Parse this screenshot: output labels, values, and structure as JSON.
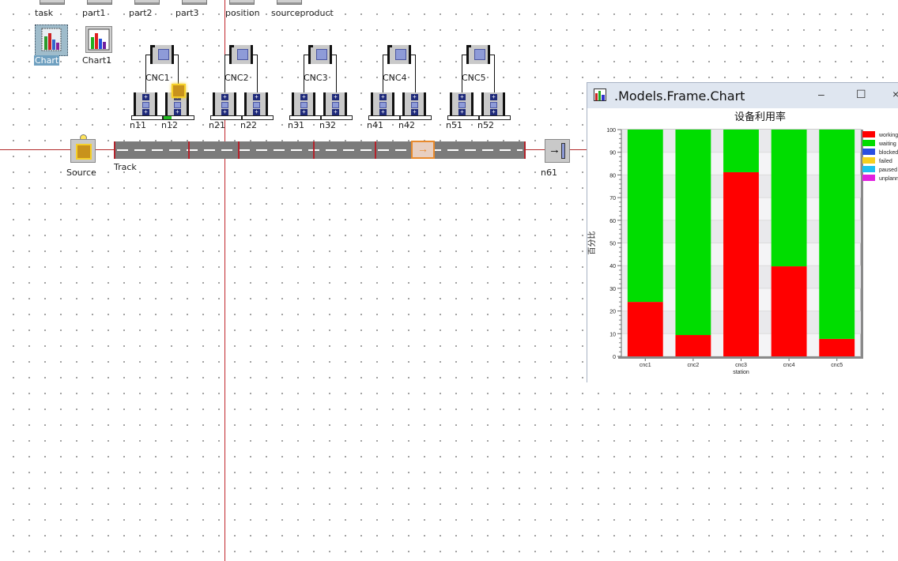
{
  "canvas": {
    "top_objects": [
      {
        "label": "task"
      },
      {
        "label": "part1"
      },
      {
        "label": "part2"
      },
      {
        "label": "part3"
      },
      {
        "label": "position"
      },
      {
        "label": "sourceproduct"
      }
    ],
    "charts": [
      {
        "label": "Chart",
        "selected": true
      },
      {
        "label": "Chart1",
        "selected": false
      }
    ],
    "stations": [
      {
        "label": "CNC1",
        "buffers": [
          "n11",
          "n12"
        ]
      },
      {
        "label": "CNC2",
        "buffers": [
          "n21",
          "n22"
        ]
      },
      {
        "label": "CNC3",
        "buffers": [
          "n31",
          "n32"
        ]
      },
      {
        "label": "CNC4",
        "buffers": [
          "n41",
          "n42"
        ]
      },
      {
        "label": "CNC5",
        "buffers": [
          "n51",
          "n52"
        ]
      }
    ],
    "source_label": "Source",
    "track_label": "Track",
    "drain_label": "n61"
  },
  "window": {
    "title": ".Models.Frame.Chart",
    "minimize": "–",
    "maximize": "☐",
    "close": "×"
  },
  "chart_data": {
    "type": "bar",
    "stacked": true,
    "title": "设备利用率",
    "xlabel": "station",
    "ylabel": "百分比",
    "categories": [
      "cnc1",
      "cnc2",
      "cnc3",
      "cnc4",
      "cnc5"
    ],
    "ylim": [
      0,
      100
    ],
    "yticks": [
      0,
      10,
      20,
      30,
      40,
      50,
      60,
      70,
      80,
      90,
      100
    ],
    "grid": true,
    "legend_position": "right",
    "series": [
      {
        "name": "working",
        "color": "#ff0000",
        "values": [
          24.0,
          9.4,
          81.2,
          39.7,
          7.7
        ]
      },
      {
        "name": "waiting",
        "color": "#00dd00",
        "values": [
          76.0,
          90.6,
          18.8,
          60.3,
          92.3
        ]
      },
      {
        "name": "blocked",
        "color": "#2a4fe0",
        "values": [
          0,
          0,
          0,
          0,
          0
        ]
      },
      {
        "name": "failed",
        "color": "#f5d020",
        "values": [
          0,
          0,
          0,
          0,
          0
        ]
      },
      {
        "name": "paused",
        "color": "#1ec0f0",
        "values": [
          0,
          0,
          0,
          0,
          0
        ]
      },
      {
        "name": "unplanned",
        "color": "#e020e0",
        "values": [
          0,
          0,
          0,
          0,
          0
        ]
      }
    ]
  }
}
